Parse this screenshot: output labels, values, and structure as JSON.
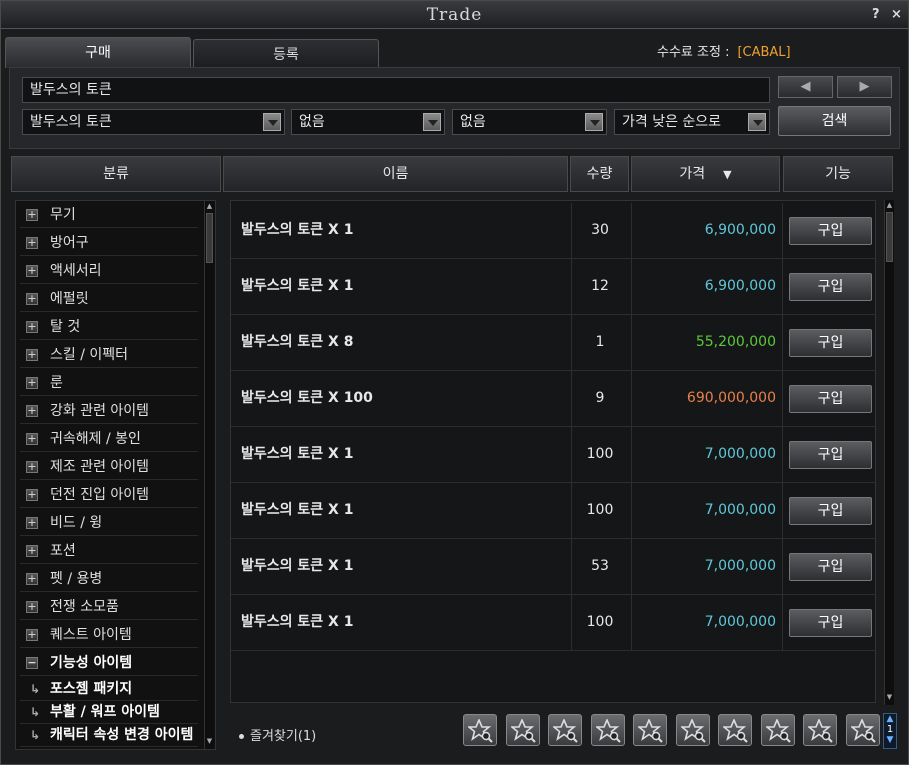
{
  "window": {
    "title": "Trade",
    "help_label": "?",
    "close_label": "×"
  },
  "tabs": [
    {
      "label": "구매"
    },
    {
      "label": "등록"
    }
  ],
  "fee": {
    "label": "수수료 조정 :",
    "value": "[CABAL]"
  },
  "search": {
    "query": "발두스의 토큰",
    "filters": [
      "발두스의 토큰",
      "없음",
      "없음",
      "가격 낮은 순으로"
    ],
    "search_button": "검색",
    "prev_label": "◀",
    "next_label": "▶"
  },
  "headers": {
    "category": "분류",
    "name": "이름",
    "qty": "수량",
    "price": "가격",
    "action": "기능",
    "sort_arrow": "▼"
  },
  "categories": [
    {
      "label": "무기",
      "toggle": "+"
    },
    {
      "label": "방어구",
      "toggle": "+"
    },
    {
      "label": "액세서리",
      "toggle": "+"
    },
    {
      "label": "에펄릿",
      "toggle": "+"
    },
    {
      "label": "탈 것",
      "toggle": "+"
    },
    {
      "label": "스킬 / 이펙터",
      "toggle": "+"
    },
    {
      "label": "룬",
      "toggle": "+"
    },
    {
      "label": "강화 관련 아이템",
      "toggle": "+"
    },
    {
      "label": "귀속해제 / 봉인",
      "toggle": "+"
    },
    {
      "label": "제조 관련 아이템",
      "toggle": "+"
    },
    {
      "label": "던전 진입 아이템",
      "toggle": "+"
    },
    {
      "label": "비드 / 윙",
      "toggle": "+"
    },
    {
      "label": "포션",
      "toggle": "+"
    },
    {
      "label": "펫 / 용병",
      "toggle": "+"
    },
    {
      "label": "전쟁 소모품",
      "toggle": "+"
    },
    {
      "label": "퀘스트 아이템",
      "toggle": "+"
    },
    {
      "label": "기능성 아이템",
      "toggle": "−"
    }
  ],
  "subcategories": [
    {
      "label": "포스젬 패키지",
      "arrow": "↳"
    },
    {
      "label": "부활 / 워프 아이템",
      "arrow": "↳"
    },
    {
      "label": "캐릭터 속성 변경 아이템",
      "arrow": "↳"
    }
  ],
  "listings": [
    {
      "name": "발두스의 토큰 X 1",
      "qty": "30",
      "price": "6,900,000",
      "price_color": "#5ec8d8",
      "action": "구입"
    },
    {
      "name": "발두스의 토큰 X 1",
      "qty": "12",
      "price": "6,900,000",
      "price_color": "#5ec8d8",
      "action": "구입"
    },
    {
      "name": "발두스의 토큰 X 8",
      "qty": "1",
      "price": "55,200,000",
      "price_color": "#5cc83a",
      "action": "구입"
    },
    {
      "name": "발두스의 토큰 X 100",
      "qty": "9",
      "price": "690,000,000",
      "price_color": "#e8804a",
      "action": "구입"
    },
    {
      "name": "발두스의 토큰 X 1",
      "qty": "100",
      "price": "7,000,000",
      "price_color": "#5ec8d8",
      "action": "구입"
    },
    {
      "name": "발두스의 토큰 X 1",
      "qty": "100",
      "price": "7,000,000",
      "price_color": "#5ec8d8",
      "action": "구입"
    },
    {
      "name": "발두스의 토큰 X 1",
      "qty": "53",
      "price": "7,000,000",
      "price_color": "#5ec8d8",
      "action": "구입"
    },
    {
      "name": "발두스의 토큰 X 1",
      "qty": "100",
      "price": "7,000,000",
      "price_color": "#5ec8d8",
      "action": "구입"
    }
  ],
  "favorites": {
    "label": "즐겨찾기(1)",
    "slot_icon": "star-search-icon",
    "page": "1"
  }
}
